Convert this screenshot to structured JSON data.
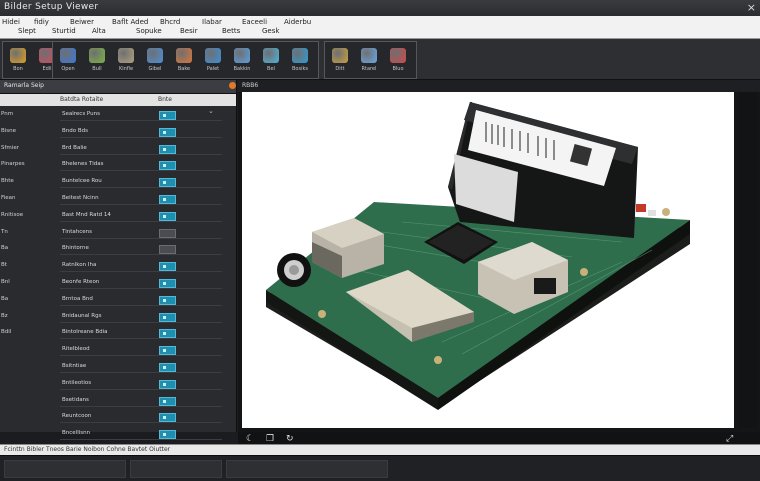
{
  "window": {
    "title": "Bilder Setup Viewer",
    "close": "×"
  },
  "menu": [
    "Hidei",
    "Slept",
    "fidiy",
    "Sturtid",
    "Beiwer",
    "Alta",
    "Baflt Aded",
    "Sopuke",
    "Bhcrd",
    "Besir",
    "Ilabar",
    "Betts",
    "Eaceeli",
    "Gesk",
    "Aiderbu"
  ],
  "toolbar": {
    "groups": [
      {
        "buttons": [
          {
            "icon": "folder-icon",
            "label": "Bon",
            "color": "#e0a020"
          },
          {
            "icon": "image-icon",
            "label": "Edil",
            "color": "#d04a60"
          }
        ]
      },
      {
        "buttons": [
          {
            "icon": "flask-icon",
            "label": "Open",
            "color": "#3b78d8"
          },
          {
            "icon": "brush-icon",
            "label": "Bull",
            "color": "#7cb342"
          },
          {
            "icon": "frame-icon",
            "label": "Kinfle",
            "color": "#b0a080"
          },
          {
            "icon": "bottle-icon",
            "label": "Gibel",
            "color": "#4a90d9"
          },
          {
            "icon": "palette-icon",
            "label": "Bake",
            "color": "#d9763a"
          },
          {
            "icon": "cloud-icon",
            "label": "Palet",
            "color": "#3c8fd8"
          },
          {
            "icon": "gear-icon",
            "label": "Bakkin",
            "color": "#5aa0e0"
          },
          {
            "icon": "jar-icon",
            "label": "Bel",
            "color": "#4fb3d9"
          },
          {
            "icon": "globe-icon",
            "label": "Bosiks",
            "color": "#2f9bd6"
          }
        ]
      },
      {
        "buttons": [
          {
            "icon": "gem-icon",
            "label": "Ditt",
            "color": "#c8a040"
          },
          {
            "icon": "cube-icon",
            "label": "Rtarel",
            "color": "#6aa8e8"
          },
          {
            "icon": "screen-icon",
            "label": "Bluo",
            "color": "#d04848"
          }
        ]
      }
    ]
  },
  "properties": {
    "title": "Ramarla Seip",
    "columns": [
      "Batdta Rotaite",
      "Bnte"
    ],
    "rows": [
      {
        "name": "Pnm",
        "value": "Sealrecs Puns",
        "swatch": true
      },
      {
        "name": "Bisne",
        "value": "Bndo Bds",
        "swatch": true
      },
      {
        "name": "Sfmier",
        "value": "Brd Balie",
        "swatch": true
      },
      {
        "name": "Pinarpes",
        "value": "Bhelenes Tidas",
        "swatch": true
      },
      {
        "name": "Bhte",
        "value": "Buntelcee Rou",
        "swatch": true
      },
      {
        "name": "Fiean",
        "value": "Beitest Ncinn",
        "swatch": true
      },
      {
        "name": "Rnitisoe",
        "value": "Bast Mnd Ratd 14",
        "swatch": true
      },
      {
        "name": "Tn",
        "value": "Tintahcens",
        "swatch": false
      },
      {
        "name": "Ba",
        "value": "Bhintorne",
        "swatch": false
      },
      {
        "name": "Bt",
        "value": "Ratnlkon Iha",
        "swatch": true
      },
      {
        "name": "Bnl",
        "value": "Beonfe Rteon",
        "swatch": true
      },
      {
        "name": "Ba",
        "value": "Brntoa Bnd",
        "swatch": true
      },
      {
        "name": "Bz",
        "value": "Bnidaunal Rgs",
        "swatch": true
      },
      {
        "name": "Bdil",
        "value": "Bintolreane Bdia",
        "swatch": true
      },
      {
        "name": "",
        "value": "Ritelbleod",
        "swatch": true
      },
      {
        "name": "",
        "value": "Bsitntiae",
        "swatch": true
      },
      {
        "name": "",
        "value": "Bntileotios",
        "swatch": true
      },
      {
        "name": "",
        "value": "Bsetidans",
        "swatch": true
      },
      {
        "name": "",
        "value": "Reuntcoon",
        "swatch": true
      },
      {
        "name": "",
        "value": "Bncellisnn",
        "swatch": true
      }
    ]
  },
  "viewer": {
    "title": "RBB6",
    "footer_icons": [
      "moon-icon",
      "copy-icon",
      "refresh-icon"
    ],
    "footer_glyphs": [
      "☾",
      "❐",
      "↻"
    ],
    "expand": "⤢"
  },
  "status": {
    "text": "Fcinttn  Bibler  Tneos  Barie  Noibon  Cohne  Bavtet  Oiutter"
  }
}
